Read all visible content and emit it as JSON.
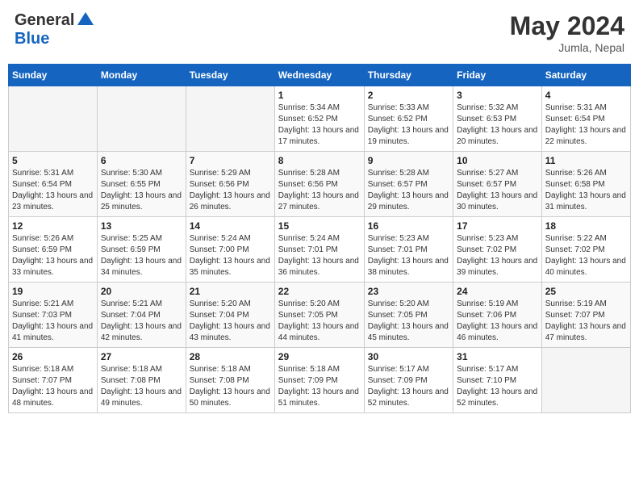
{
  "header": {
    "logo_general": "General",
    "logo_blue": "Blue",
    "month_title": "May 2024",
    "location": "Jumla, Nepal"
  },
  "weekdays": [
    "Sunday",
    "Monday",
    "Tuesday",
    "Wednesday",
    "Thursday",
    "Friday",
    "Saturday"
  ],
  "weeks": [
    [
      {
        "day": "",
        "info": ""
      },
      {
        "day": "",
        "info": ""
      },
      {
        "day": "",
        "info": ""
      },
      {
        "day": "1",
        "info": "Sunrise: 5:34 AM\nSunset: 6:52 PM\nDaylight: 13 hours and 17 minutes."
      },
      {
        "day": "2",
        "info": "Sunrise: 5:33 AM\nSunset: 6:52 PM\nDaylight: 13 hours and 19 minutes."
      },
      {
        "day": "3",
        "info": "Sunrise: 5:32 AM\nSunset: 6:53 PM\nDaylight: 13 hours and 20 minutes."
      },
      {
        "day": "4",
        "info": "Sunrise: 5:31 AM\nSunset: 6:54 PM\nDaylight: 13 hours and 22 minutes."
      }
    ],
    [
      {
        "day": "5",
        "info": "Sunrise: 5:31 AM\nSunset: 6:54 PM\nDaylight: 13 hours and 23 minutes."
      },
      {
        "day": "6",
        "info": "Sunrise: 5:30 AM\nSunset: 6:55 PM\nDaylight: 13 hours and 25 minutes."
      },
      {
        "day": "7",
        "info": "Sunrise: 5:29 AM\nSunset: 6:56 PM\nDaylight: 13 hours and 26 minutes."
      },
      {
        "day": "8",
        "info": "Sunrise: 5:28 AM\nSunset: 6:56 PM\nDaylight: 13 hours and 27 minutes."
      },
      {
        "day": "9",
        "info": "Sunrise: 5:28 AM\nSunset: 6:57 PM\nDaylight: 13 hours and 29 minutes."
      },
      {
        "day": "10",
        "info": "Sunrise: 5:27 AM\nSunset: 6:57 PM\nDaylight: 13 hours and 30 minutes."
      },
      {
        "day": "11",
        "info": "Sunrise: 5:26 AM\nSunset: 6:58 PM\nDaylight: 13 hours and 31 minutes."
      }
    ],
    [
      {
        "day": "12",
        "info": "Sunrise: 5:26 AM\nSunset: 6:59 PM\nDaylight: 13 hours and 33 minutes."
      },
      {
        "day": "13",
        "info": "Sunrise: 5:25 AM\nSunset: 6:59 PM\nDaylight: 13 hours and 34 minutes."
      },
      {
        "day": "14",
        "info": "Sunrise: 5:24 AM\nSunset: 7:00 PM\nDaylight: 13 hours and 35 minutes."
      },
      {
        "day": "15",
        "info": "Sunrise: 5:24 AM\nSunset: 7:01 PM\nDaylight: 13 hours and 36 minutes."
      },
      {
        "day": "16",
        "info": "Sunrise: 5:23 AM\nSunset: 7:01 PM\nDaylight: 13 hours and 38 minutes."
      },
      {
        "day": "17",
        "info": "Sunrise: 5:23 AM\nSunset: 7:02 PM\nDaylight: 13 hours and 39 minutes."
      },
      {
        "day": "18",
        "info": "Sunrise: 5:22 AM\nSunset: 7:02 PM\nDaylight: 13 hours and 40 minutes."
      }
    ],
    [
      {
        "day": "19",
        "info": "Sunrise: 5:21 AM\nSunset: 7:03 PM\nDaylight: 13 hours and 41 minutes."
      },
      {
        "day": "20",
        "info": "Sunrise: 5:21 AM\nSunset: 7:04 PM\nDaylight: 13 hours and 42 minutes."
      },
      {
        "day": "21",
        "info": "Sunrise: 5:20 AM\nSunset: 7:04 PM\nDaylight: 13 hours and 43 minutes."
      },
      {
        "day": "22",
        "info": "Sunrise: 5:20 AM\nSunset: 7:05 PM\nDaylight: 13 hours and 44 minutes."
      },
      {
        "day": "23",
        "info": "Sunrise: 5:20 AM\nSunset: 7:05 PM\nDaylight: 13 hours and 45 minutes."
      },
      {
        "day": "24",
        "info": "Sunrise: 5:19 AM\nSunset: 7:06 PM\nDaylight: 13 hours and 46 minutes."
      },
      {
        "day": "25",
        "info": "Sunrise: 5:19 AM\nSunset: 7:07 PM\nDaylight: 13 hours and 47 minutes."
      }
    ],
    [
      {
        "day": "26",
        "info": "Sunrise: 5:18 AM\nSunset: 7:07 PM\nDaylight: 13 hours and 48 minutes."
      },
      {
        "day": "27",
        "info": "Sunrise: 5:18 AM\nSunset: 7:08 PM\nDaylight: 13 hours and 49 minutes."
      },
      {
        "day": "28",
        "info": "Sunrise: 5:18 AM\nSunset: 7:08 PM\nDaylight: 13 hours and 50 minutes."
      },
      {
        "day": "29",
        "info": "Sunrise: 5:18 AM\nSunset: 7:09 PM\nDaylight: 13 hours and 51 minutes."
      },
      {
        "day": "30",
        "info": "Sunrise: 5:17 AM\nSunset: 7:09 PM\nDaylight: 13 hours and 52 minutes."
      },
      {
        "day": "31",
        "info": "Sunrise: 5:17 AM\nSunset: 7:10 PM\nDaylight: 13 hours and 52 minutes."
      },
      {
        "day": "",
        "info": ""
      }
    ]
  ]
}
